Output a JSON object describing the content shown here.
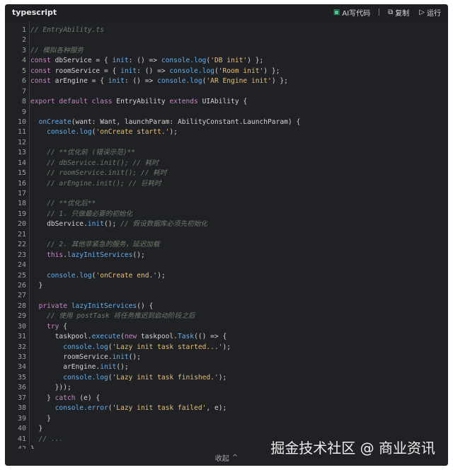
{
  "header": {
    "language": "typescript",
    "ai_label": "AI写代码",
    "copy_label": "复制",
    "run_label": "运行"
  },
  "code": {
    "lines": [
      [
        {
          "t": "c",
          "v": "// EntryAbility.ts"
        }
      ],
      [],
      [
        {
          "t": "c",
          "v": "// 模拟各种服务"
        }
      ],
      [
        {
          "t": "k",
          "v": "const "
        },
        {
          "t": "t",
          "v": "dbService = { "
        },
        {
          "t": "f",
          "v": "init"
        },
        {
          "t": "t",
          "v": ": () => "
        },
        {
          "t": "f",
          "v": "console.log"
        },
        {
          "t": "t",
          "v": "("
        },
        {
          "t": "s",
          "v": "'DB init'"
        },
        {
          "t": "t",
          "v": ") };"
        }
      ],
      [
        {
          "t": "k",
          "v": "const "
        },
        {
          "t": "t",
          "v": "roomService = { "
        },
        {
          "t": "f",
          "v": "init"
        },
        {
          "t": "t",
          "v": ": () => "
        },
        {
          "t": "f",
          "v": "console.log"
        },
        {
          "t": "t",
          "v": "("
        },
        {
          "t": "s",
          "v": "'Room init'"
        },
        {
          "t": "t",
          "v": ") };"
        }
      ],
      [
        {
          "t": "k",
          "v": "const "
        },
        {
          "t": "t",
          "v": "arEngine = { "
        },
        {
          "t": "f",
          "v": "init"
        },
        {
          "t": "t",
          "v": ": () => "
        },
        {
          "t": "f",
          "v": "console.log"
        },
        {
          "t": "t",
          "v": "("
        },
        {
          "t": "s",
          "v": "'AR Engine init'"
        },
        {
          "t": "t",
          "v": ") };"
        }
      ],
      [],
      [
        {
          "t": "k",
          "v": "export default class "
        },
        {
          "t": "t",
          "v": "EntryAbility "
        },
        {
          "t": "k",
          "v": "extends "
        },
        {
          "t": "t",
          "v": "UIAbility {"
        }
      ],
      [],
      [
        {
          "t": "t",
          "v": "  "
        },
        {
          "t": "f",
          "v": "onCreate"
        },
        {
          "t": "t",
          "v": "(want: Want, launchParam: AbilityConstant.LaunchParam) {"
        }
      ],
      [
        {
          "t": "t",
          "v": "    "
        },
        {
          "t": "f",
          "v": "console.log"
        },
        {
          "t": "t",
          "v": "("
        },
        {
          "t": "s",
          "v": "'onCreate startt.'"
        },
        {
          "t": "t",
          "v": ");"
        }
      ],
      [],
      [
        {
          "t": "t",
          "v": "    "
        },
        {
          "t": "c",
          "v": "// **优化前 (错误示范)**"
        }
      ],
      [
        {
          "t": "t",
          "v": "    "
        },
        {
          "t": "c",
          "v": "// dbService.init(); // 耗时"
        }
      ],
      [
        {
          "t": "t",
          "v": "    "
        },
        {
          "t": "c",
          "v": "// roomService.init(); // 耗时"
        }
      ],
      [
        {
          "t": "t",
          "v": "    "
        },
        {
          "t": "c",
          "v": "// arEngine.init(); // 巨耗时"
        }
      ],
      [],
      [
        {
          "t": "t",
          "v": "    "
        },
        {
          "t": "c",
          "v": "// **优化后**"
        }
      ],
      [
        {
          "t": "t",
          "v": "    "
        },
        {
          "t": "c",
          "v": "// 1. 只做最必要的初始化"
        }
      ],
      [
        {
          "t": "t",
          "v": "    dbService."
        },
        {
          "t": "f",
          "v": "init"
        },
        {
          "t": "t",
          "v": "(); "
        },
        {
          "t": "c",
          "v": "// 假设数据库必须先初始化"
        }
      ],
      [],
      [
        {
          "t": "t",
          "v": "    "
        },
        {
          "t": "c",
          "v": "// 2. 其他非紧急的服务，延迟加载"
        }
      ],
      [
        {
          "t": "t",
          "v": "    "
        },
        {
          "t": "k",
          "v": "this"
        },
        {
          "t": "t",
          "v": "."
        },
        {
          "t": "f",
          "v": "lazyInitServices"
        },
        {
          "t": "t",
          "v": "();"
        }
      ],
      [],
      [
        {
          "t": "t",
          "v": "    "
        },
        {
          "t": "f",
          "v": "console.log"
        },
        {
          "t": "t",
          "v": "("
        },
        {
          "t": "s",
          "v": "'onCreate end.'"
        },
        {
          "t": "t",
          "v": ");"
        }
      ],
      [
        {
          "t": "t",
          "v": "  }"
        }
      ],
      [],
      [
        {
          "t": "t",
          "v": "  "
        },
        {
          "t": "k",
          "v": "private "
        },
        {
          "t": "f",
          "v": "lazyInitServices"
        },
        {
          "t": "t",
          "v": "() {"
        }
      ],
      [
        {
          "t": "t",
          "v": "    "
        },
        {
          "t": "c",
          "v": "// 使用 postTask 将任务推迟到启动阶段之后"
        }
      ],
      [
        {
          "t": "t",
          "v": "    "
        },
        {
          "t": "k",
          "v": "try"
        },
        {
          "t": "t",
          "v": " {"
        }
      ],
      [
        {
          "t": "t",
          "v": "      taskpool."
        },
        {
          "t": "f",
          "v": "execute"
        },
        {
          "t": "t",
          "v": "("
        },
        {
          "t": "k",
          "v": "new "
        },
        {
          "t": "t",
          "v": "taskpool."
        },
        {
          "t": "f",
          "v": "Task"
        },
        {
          "t": "t",
          "v": "(() => {"
        }
      ],
      [
        {
          "t": "t",
          "v": "        "
        },
        {
          "t": "f",
          "v": "console.log"
        },
        {
          "t": "t",
          "v": "("
        },
        {
          "t": "s",
          "v": "'Lazy init task started...'"
        },
        {
          "t": "t",
          "v": ");"
        }
      ],
      [
        {
          "t": "t",
          "v": "        roomService."
        },
        {
          "t": "f",
          "v": "init"
        },
        {
          "t": "t",
          "v": "();"
        }
      ],
      [
        {
          "t": "t",
          "v": "        arEngine."
        },
        {
          "t": "f",
          "v": "init"
        },
        {
          "t": "t",
          "v": "();"
        }
      ],
      [
        {
          "t": "t",
          "v": "        "
        },
        {
          "t": "f",
          "v": "console.log"
        },
        {
          "t": "t",
          "v": "("
        },
        {
          "t": "s",
          "v": "'Lazy init task finished.'"
        },
        {
          "t": "t",
          "v": ");"
        }
      ],
      [
        {
          "t": "t",
          "v": "      }));"
        }
      ],
      [
        {
          "t": "t",
          "v": "    } "
        },
        {
          "t": "k",
          "v": "catch"
        },
        {
          "t": "t",
          "v": " (e) {"
        }
      ],
      [
        {
          "t": "t",
          "v": "      "
        },
        {
          "t": "f",
          "v": "console.error"
        },
        {
          "t": "t",
          "v": "("
        },
        {
          "t": "s",
          "v": "'Lazy init task failed'"
        },
        {
          "t": "t",
          "v": ", e);"
        }
      ],
      [
        {
          "t": "t",
          "v": "    }"
        }
      ],
      [
        {
          "t": "t",
          "v": "  }"
        }
      ],
      [
        {
          "t": "t",
          "v": "  "
        },
        {
          "t": "c",
          "v": "// ..."
        }
      ],
      [
        {
          "t": "t",
          "v": "}"
        }
      ]
    ]
  },
  "footer": {
    "collapse_label": "收起"
  },
  "watermark": "掘金技术社区 @ 商业资讯",
  "colors": {
    "background": "#202124",
    "comment": "#6b7d6b",
    "keyword": "#c586c0",
    "function": "#61afef",
    "string": "#e5c07b",
    "ai_accent": "#3ecf8e"
  }
}
